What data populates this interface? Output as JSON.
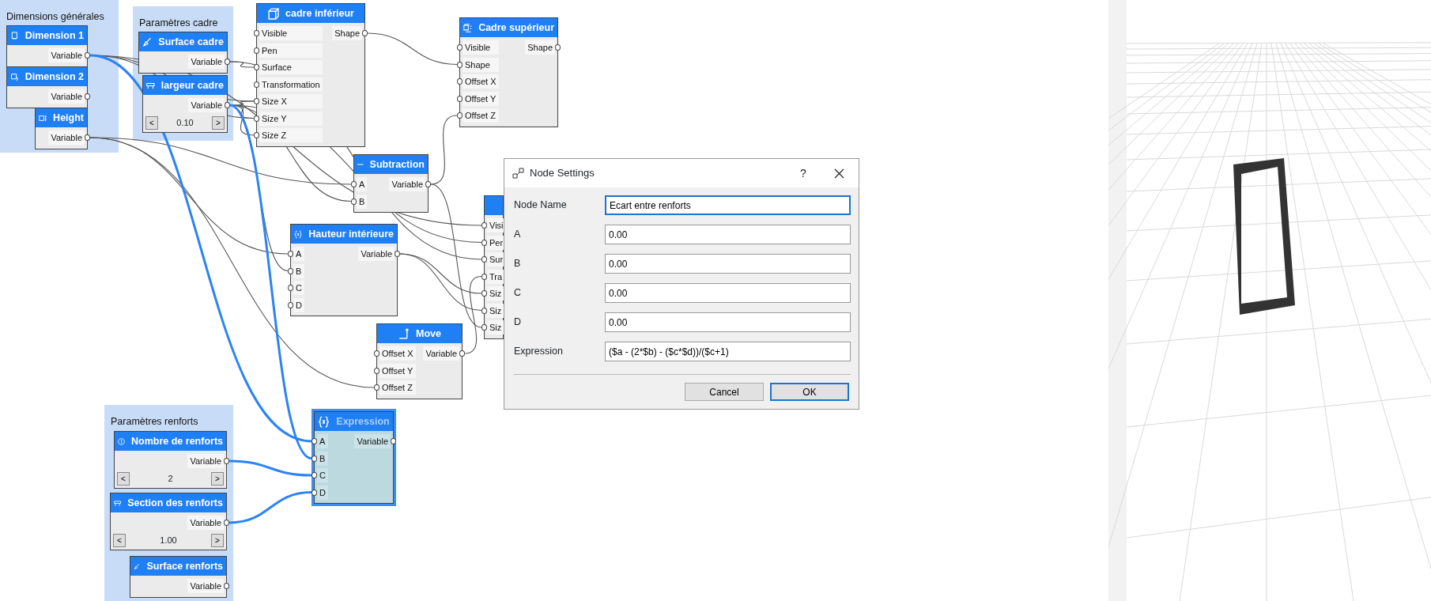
{
  "groups": [
    {
      "title": "Dimensions générales"
    },
    {
      "title": "Paramètres cadre"
    },
    {
      "title": "Paramètres renforts"
    }
  ],
  "nodes": [
    {
      "title": "Dimension 1",
      "kind": "value",
      "outputs": [
        "Variable"
      ],
      "selected": false
    },
    {
      "title": "Dimension 2",
      "kind": "value",
      "outputs": [
        "Variable"
      ],
      "selected": false
    },
    {
      "title": "Height",
      "kind": "value",
      "outputs": [
        "Variable"
      ],
      "selected": false
    },
    {
      "title": "Surface cadre",
      "kind": "value",
      "outputs": [
        "Variable"
      ],
      "selected": false
    },
    {
      "title": "largeur cadre",
      "kind": "stepper",
      "outputs": [
        "Variable"
      ],
      "stepper": {
        "dec": "<",
        "value": "0.10",
        "inc": ">"
      },
      "selected": false
    },
    {
      "title": "cadre inférieur",
      "kind": "shape",
      "inputs": [
        "Visible",
        "Pen",
        "Surface",
        "Transformation",
        "Size X",
        "Size Y",
        "Size Z"
      ],
      "outputs": [
        "Shape"
      ],
      "selected": false
    },
    {
      "title": "Cadre supérieur",
      "kind": "shape",
      "inputs": [
        "Visible",
        "Shape",
        "Offset X",
        "Offset Y",
        "Offset Z"
      ],
      "outputs": [
        "Shape"
      ],
      "selected": false
    },
    {
      "title": "Subtraction",
      "kind": "operation",
      "inputs": [
        "A",
        "B"
      ],
      "outputs": [
        "Variable"
      ],
      "selected": false
    },
    {
      "title": "Hauteur intérieure",
      "kind": "operation",
      "inputs": [
        "A",
        "B",
        "C",
        "D"
      ],
      "outputs": [
        "Variable"
      ],
      "selected": false
    },
    {
      "kind": "shape",
      "inputs": [
        "Visi",
        "Per",
        "Sur",
        "Tra",
        "Siz",
        "Siz",
        "Siz"
      ],
      "selected": false
    },
    {
      "title": "Move",
      "kind": "operation",
      "inputs": [
        "Offset X",
        "Offset Y",
        "Offset Z"
      ],
      "outputs": [
        "Variable"
      ],
      "selected": false
    },
    {
      "title": "Nombre de renforts",
      "kind": "stepper",
      "outputs": [
        "Variable"
      ],
      "stepper": {
        "dec": "<",
        "value": "2",
        "inc": ">"
      },
      "selected": false
    },
    {
      "title": "Section des renforts",
      "kind": "stepper",
      "outputs": [
        "Variable"
      ],
      "stepper": {
        "dec": "<",
        "value": "1.00",
        "inc": ">"
      },
      "selected": false
    },
    {
      "title": "Expression",
      "kind": "operation",
      "inputs": [
        "A",
        "B",
        "C",
        "D"
      ],
      "outputs": [
        "Variable"
      ],
      "selected": true
    },
    {
      "title": "Surface renforts",
      "kind": "value",
      "outputs": [
        "Variable"
      ],
      "selected": false
    }
  ],
  "dialog": {
    "title": "Node Settings",
    "help": "?",
    "fields": [
      {
        "label": "Node Name",
        "value": "Ecart entre renforts",
        "focused": true
      },
      {
        "label": "A",
        "value": "0.00",
        "focused": false
      },
      {
        "label": "B",
        "value": "0.00",
        "focused": false
      },
      {
        "label": "C",
        "value": "0.00",
        "focused": false
      },
      {
        "label": "D",
        "value": "0.00",
        "focused": false
      },
      {
        "label": "Expression",
        "value": "($a - (2*$b) - ($c*$d))/($c+1)",
        "focused": false
      }
    ],
    "buttons": [
      {
        "label": "Cancel",
        "default": false
      },
      {
        "label": "OK",
        "default": true
      }
    ]
  }
}
